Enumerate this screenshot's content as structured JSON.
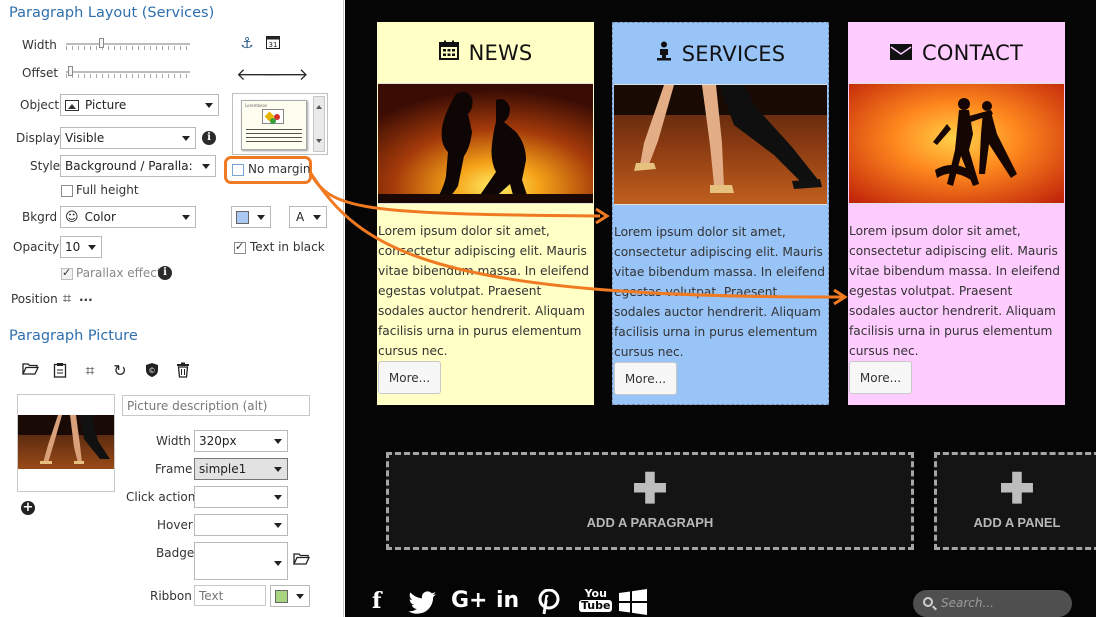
{
  "layout_section": {
    "title": "Paragraph Layout (Services)",
    "width_label": "Width",
    "offset_label": "Offset",
    "width_slider_fraction": 0.28,
    "offset_slider_fraction": 0.02,
    "object_label": "Object",
    "object_value": "Picture",
    "display_label": "Display",
    "display_value": "Visible",
    "style_label": "Style",
    "style_value": "Background / Paralla:",
    "no_margin_label": "No margin",
    "full_height_label": "Full height",
    "bkgrd_label": "Bkgrd",
    "bkgrd_value": "Color",
    "text_color_value": "A",
    "opacity_label": "Opacity",
    "opacity_value": "10",
    "text_in_black_label": "Text in black",
    "parallax_label": "Parallax effect",
    "position_label": "Position",
    "position_ellipsis": "...",
    "thumb_caption": "Lorembeos",
    "swatch_color": "#a9c8f2",
    "highlight_color": "#f07a22"
  },
  "picture_section": {
    "title": "Paragraph Picture",
    "alt_placeholder": "Picture description (alt)",
    "width_label": "Width",
    "width_value": "320px",
    "frame_label": "Frame",
    "frame_value": "simple1",
    "click_label": "Click action",
    "hover_label": "Hover",
    "badge_label": "Badge",
    "ribbon_label": "Ribbon",
    "ribbon_placeholder": "Text",
    "ribbon_color": "#a8d680"
  },
  "cards": [
    {
      "title": "NEWS",
      "icon": "calendar-icon",
      "bg": "#ffffc6",
      "text": "Lorem ipsum dolor sit amet, consectetur adipiscing elit. Mauris vitae bibendum massa. In eleifend egestas volutpat. Praesent sodales auctor hendrerit. Aliquam facilisis urna in purus elementum cursus nec.",
      "button": "More..."
    },
    {
      "title": "SERVICES",
      "icon": "person-icon",
      "bg": "#99c4f7",
      "text": "Lorem ipsum dolor sit amet, consectetur adipiscing elit. Mauris vitae bibendum massa. In eleifend egestas volutpat. Praesent sodales auctor hendrerit. Aliquam facilisis urna in purus elementum cursus nec.",
      "button": "More..."
    },
    {
      "title": "CONTACT",
      "icon": "envelope-icon",
      "bg": "#ffccff",
      "text": "Lorem ipsum dolor sit amet, consectetur adipiscing elit. Mauris vitae bibendum massa. In eleifend egestas volutpat. Praesent sodales auctor hendrerit. Aliquam facilisis urna in purus elementum cursus nec.",
      "button": "More..."
    }
  ],
  "add_paragraph_label": "ADD A PARAGRAPH",
  "add_panel_label": "ADD A PANEL",
  "social": {
    "google": "G+",
    "linkedin": "in",
    "youtube_top": "You",
    "youtube_bottom": "Tube"
  },
  "search_placeholder": "Search..."
}
